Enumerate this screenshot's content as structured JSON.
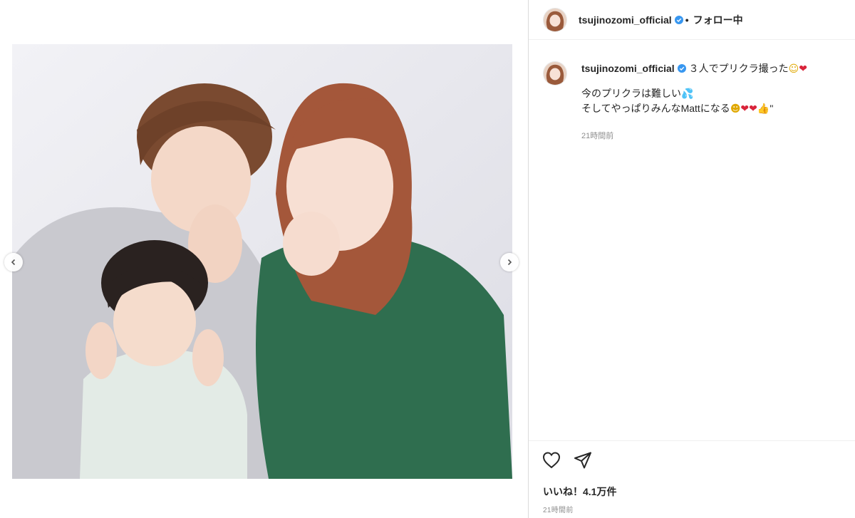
{
  "post": {
    "username": "tsujinozomi_official",
    "follow_separator": "•",
    "follow_status": "フォロー中",
    "caption": {
      "line1": "３人でプリクラ撮った",
      "line2": "今のプリクラは難しい",
      "line3": "そしてやっぱりみんなMattになる",
      "line3_suffix": "\""
    },
    "caption_time": "21時間前",
    "likes_text": "いいね！4.1万件",
    "post_time": "21時間前"
  },
  "icons": {
    "verified": "verified-badge-icon",
    "like": "heart-outline-icon",
    "share": "paper-plane-icon",
    "prev": "chevron-left-icon",
    "next": "chevron-right-icon"
  },
  "colors": {
    "verified": "#3897f0",
    "secondary_text": "#8e8e8e",
    "border": "#dbdbdb"
  }
}
